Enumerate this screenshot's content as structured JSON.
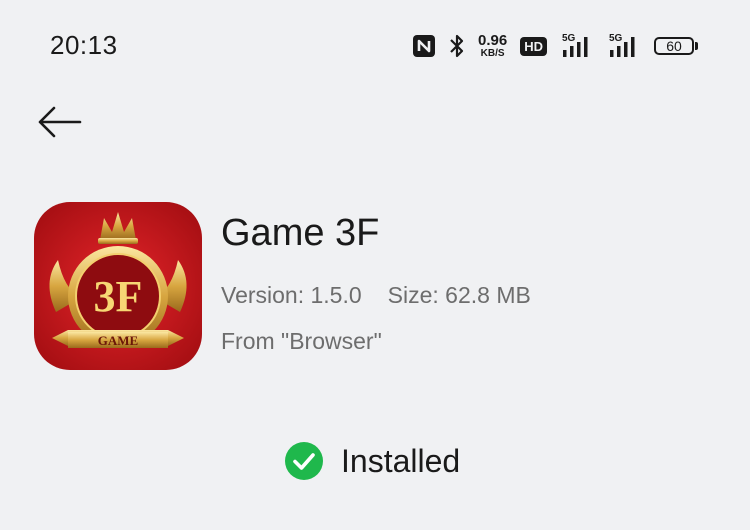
{
  "status_bar": {
    "time": "20:13",
    "icons": [
      "nfc-icon",
      "bluetooth-icon",
      "network-speed",
      "hd-voice-icon",
      "signal-icon",
      "signal-icon",
      "battery-icon"
    ],
    "net_speed_value": "0.96",
    "net_speed_unit": "KB/S",
    "hd_label": "HD",
    "signal1_tag": "5G",
    "signal2_tag": "5G",
    "battery_level": "60"
  },
  "header": {
    "back_icon": "arrow-left-icon"
  },
  "app": {
    "name": "Game 3F",
    "version": "Version: 1.5.0",
    "size": "Size: 62.8 MB",
    "source": "From \"Browser\"",
    "icon_text": "3F",
    "icon_banner": "GAME"
  },
  "install": {
    "status": "Installed",
    "icon": "check-circle-icon",
    "accent": "#1fb84c"
  }
}
